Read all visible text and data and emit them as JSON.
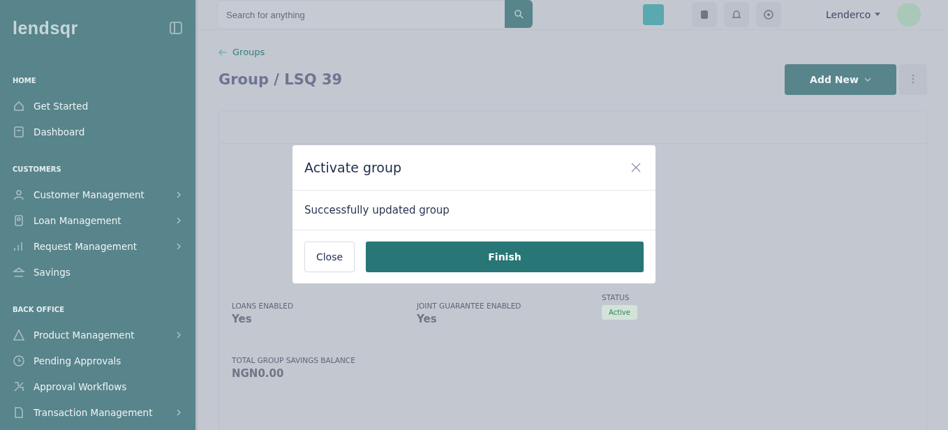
{
  "sidebar": {
    "logo": "lendsqr",
    "sections": [
      {
        "title": "HOME",
        "items": [
          {
            "label": "Get Started",
            "expandable": false
          },
          {
            "label": "Dashboard",
            "expandable": false
          }
        ]
      },
      {
        "title": "CUSTOMERS",
        "items": [
          {
            "label": "Customer Management",
            "expandable": true
          },
          {
            "label": "Loan Management",
            "expandable": true
          },
          {
            "label": "Request Management",
            "expandable": true
          },
          {
            "label": "Savings",
            "expandable": false
          }
        ]
      },
      {
        "title": "BACK OFFICE",
        "items": [
          {
            "label": "Product Management",
            "expandable": true
          },
          {
            "label": "Pending Approvals",
            "expandable": false
          },
          {
            "label": "Approval Workflows",
            "expandable": false
          },
          {
            "label": "Transaction Management",
            "expandable": true
          }
        ]
      }
    ]
  },
  "topbar": {
    "search": {
      "placeholder": "Search for anything"
    },
    "user": "Lenderco"
  },
  "page": {
    "back_link": "Groups",
    "title": "Group / LSQ 39",
    "add_button": "Add New"
  },
  "details": [
    {
      "label": "LOANS ENABLED",
      "value": "Yes",
      "kind": "text"
    },
    {
      "label": "JOINT GUARANTEE ENABLED",
      "value": "Yes",
      "kind": "text"
    },
    {
      "label": "STATUS",
      "value": "Active",
      "kind": "badge"
    },
    {
      "label": "TOTAL GROUP SAVINGS BALANCE",
      "value": "NGN0.00",
      "kind": "text"
    }
  ],
  "modal": {
    "title": "Activate group",
    "message": "Successfully updated group",
    "buttons": [
      {
        "label": "Close",
        "kind": "secondary"
      },
      {
        "label": "Finish",
        "kind": "primary"
      }
    ]
  }
}
